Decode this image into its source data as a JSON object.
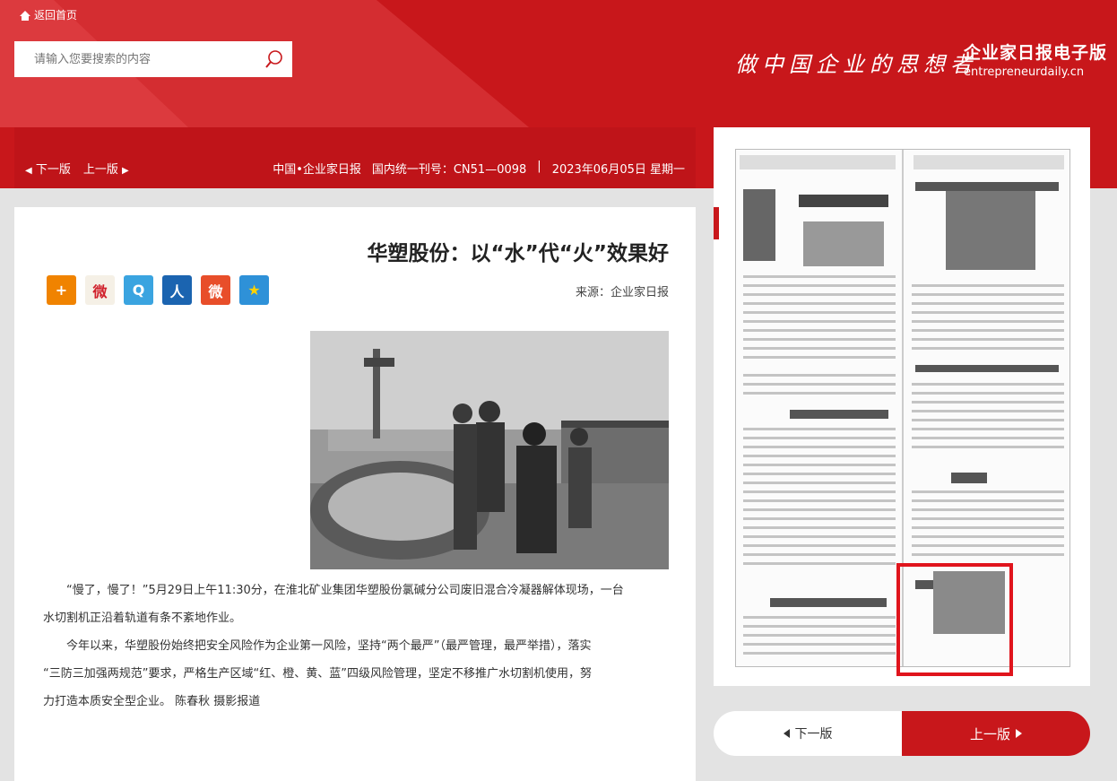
{
  "header": {
    "home_label": "返回首页",
    "search_placeholder": "请输入您要搜索的内容",
    "slogan": "做中国企业的思想者",
    "brand_name": "企业家日报电子版",
    "brand_domain": "entrepreneurdaily.cn"
  },
  "infobar": {
    "prev_page": "上一版",
    "next_page": "下一版",
    "date": "2023年06月05日 星期一",
    "issn": "国内统一刊号：CN51—0098",
    "paper": "中国•企业家日报"
  },
  "article": {
    "title": "华塑股份：以“水”代“火”效果好",
    "source": "来源：企业家日报",
    "share_icons": [
      "qzone-icon",
      "sina-weibo-icon",
      "renren-icon",
      "tencent-weibo-icon",
      "qq-share-icon",
      "more-share-icon"
    ],
    "paragraphs": [
      "“慢了，慢了！”5月29日上午11:30分，在淮北矿业集团华塑股份氯碱分公司废旧混合冷凝器解体现场，一台",
      "水切割机正沿着轨道有条不紊地作业。",
      "今年以来，华塑股份始终把安全风险作为企业第一风险，坚持“两个最严”（最严管理，最严举措），落实",
      "“三防三加强两规范”要求，严格生产区域“红、橙、黄、蓝”四级风险管理，坚定不移推广水切割机使用，努",
      "力打造本质安全型企业。 陈春秋 摄影报道"
    ]
  },
  "nav_buttons": {
    "prev_label": "上一版",
    "next_label": "下一版"
  },
  "colors": {
    "brand_red": "#c8171b",
    "highlight_red": "#e0141c"
  }
}
